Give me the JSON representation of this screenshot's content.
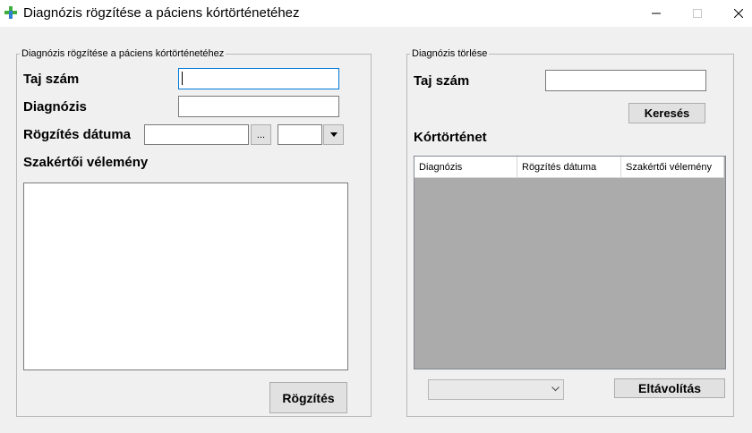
{
  "window": {
    "title": "Diagnózis rögzítése a páciens kórtörténetéhez",
    "icon": "medical-cross-icon"
  },
  "left_group": {
    "legend": "Diagnózis rögzítése a páciens kórtörténetéhez",
    "taj_label": "Taj szám",
    "taj_value": "",
    "diagnozis_label": "Diagnózis",
    "diagnozis_value": "",
    "datum_label": "Rögzítés dátuma",
    "datum_value": "",
    "datum_browse_label": "...",
    "time_value": "",
    "velemeny_label": "Szakértői vélemény",
    "velemeny_value": "",
    "save_button": "Rögzítés"
  },
  "right_group": {
    "legend": "Diagnózis törlése",
    "taj_label": "Taj szám",
    "taj_value": "",
    "search_button": "Keresés",
    "history_label": "Kórtörténet",
    "grid_columns": [
      "Diagnózis",
      "Rögzítés dátuma",
      "Szakértői vélemény"
    ],
    "grid_rows": [],
    "select_value": "",
    "remove_button": "Eltávolítás"
  },
  "colors": {
    "accent": "#0078d7",
    "icon_green": "#3fae3f",
    "icon_blue": "#2e7fd0"
  }
}
